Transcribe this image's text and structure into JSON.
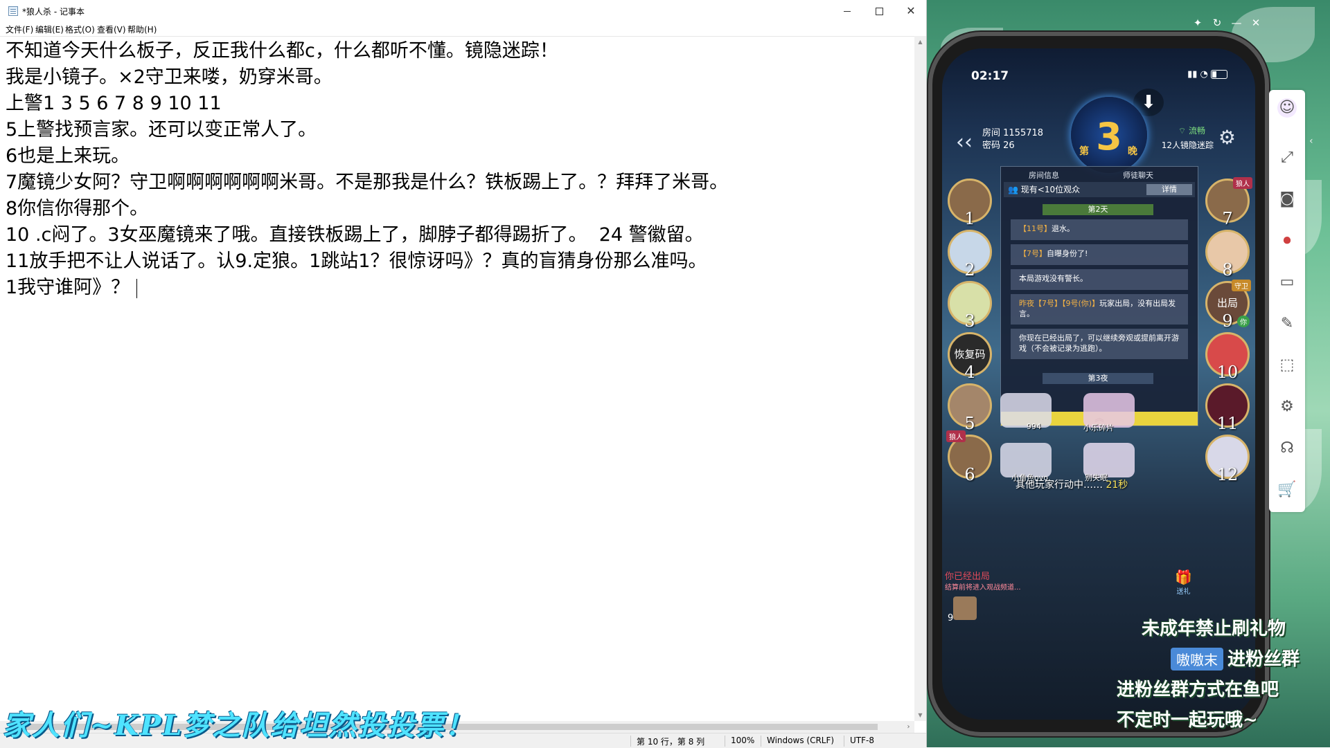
{
  "notepad": {
    "title": "*狼人杀 - 记事本",
    "menu": [
      "文件(F)",
      "编辑(E)",
      "格式(O)",
      "查看(V)",
      "帮助(H)"
    ],
    "lines": [
      "不知道今天什么板子，反正我什么都c，什么都听不懂。镜隐迷踪！",
      "我是小镜子。×2守卫来喽，奶穿米哥。",
      "上警1 3 5 6 7 8 9 10 11",
      "5上警找预言家。还可以变正常人了。",
      "6也是上来玩。",
      "7魔镜少女阿？守卫啊啊啊啊啊啊米哥。不是那我是什么？铁板踢上了。？拜拜了米哥。",
      "8你信你得那个。",
      "10 .c闷了。3女巫魔镜来了哦。直接铁板踢上了，脚脖子都得踢折了。  24 警徽留。",
      "11放手把不让人说话了。认9.定狼。1跳站1？很惊讶吗》？真的盲猜身份那么准吗。",
      "1我守谁阿》？"
    ],
    "status": {
      "position": "第 10 行，第 8 列",
      "zoom": "100%",
      "line_ending": "Windows (CRLF)",
      "encoding": "UTF-8"
    }
  },
  "overlay_banner": "家人们~KPL梦之队给坦然投投票！",
  "phone": {
    "time": "02:17",
    "room_id": "房间 1155718",
    "room_pwd": "密码 26",
    "day_pre": "第",
    "day_num": "3",
    "day_post": "晚",
    "signal": "流畅",
    "mode": "12人镜隐迷踪",
    "tabs": [
      "房间信息",
      "师徒聊天"
    ],
    "viewers": "现有<10位观众",
    "detail_btn": "详情",
    "day2_label": "第2天",
    "night3_label": "第3夜",
    "messages": [
      {
        "tag": "【11号】",
        "text": "退水。"
      },
      {
        "tag": "【7号】",
        "text": "自曝身份了!"
      },
      {
        "tag": "",
        "text": "本局游戏没有警长。"
      },
      {
        "tag": "昨夜【7号】【9号(你)】",
        "text": "玩家出局，没有出局发言。"
      },
      {
        "tag": "",
        "text": "你现在已经出局了，可以继续旁观或提前离开游戏（不会被记录为逃跑）。"
      }
    ],
    "seats_left": [
      "1",
      "2",
      "3",
      "4",
      "5",
      "6"
    ],
    "seats_right": [
      "7",
      "8",
      "9",
      "10",
      "11",
      "12"
    ],
    "seat4_text": "恢复码",
    "seat9_text": "出局",
    "tag_wolf": "狼人",
    "tag_guard": "守卫",
    "tag_you": "你",
    "player_names": [
      "994",
      "小乐碎片",
      "小角色ovo",
      "别失眠"
    ],
    "action_text": "其他玩家行动中……",
    "action_seconds": "21秒",
    "out_text": "你已经出局",
    "out_sub": "结算前将进入观战频道...",
    "gift_label": "送礼",
    "mini_num": "9"
  },
  "stream_overlay": {
    "line1": "未成年禁止刷礼物",
    "name": "嗷嗷末",
    "line2": "进粉丝群",
    "line3": "进粉丝群方式在鱼吧",
    "line4": "不定时一起玩哦~"
  },
  "icons": {
    "download": "download-icon",
    "back": "back-chevron-icon",
    "gear": "gear-icon",
    "expand": "expand-icon",
    "camera": "camera-icon",
    "record": "record-icon",
    "screen": "screen-icon",
    "brush": "brush-icon",
    "crop": "crop-icon",
    "settings": "settings-icon",
    "headset": "headset-icon",
    "cart": "cart-icon"
  },
  "colors": {
    "banner": "#4fe3ff",
    "day_badge": "#f6c544",
    "wolf_tag": "#b0304a"
  }
}
